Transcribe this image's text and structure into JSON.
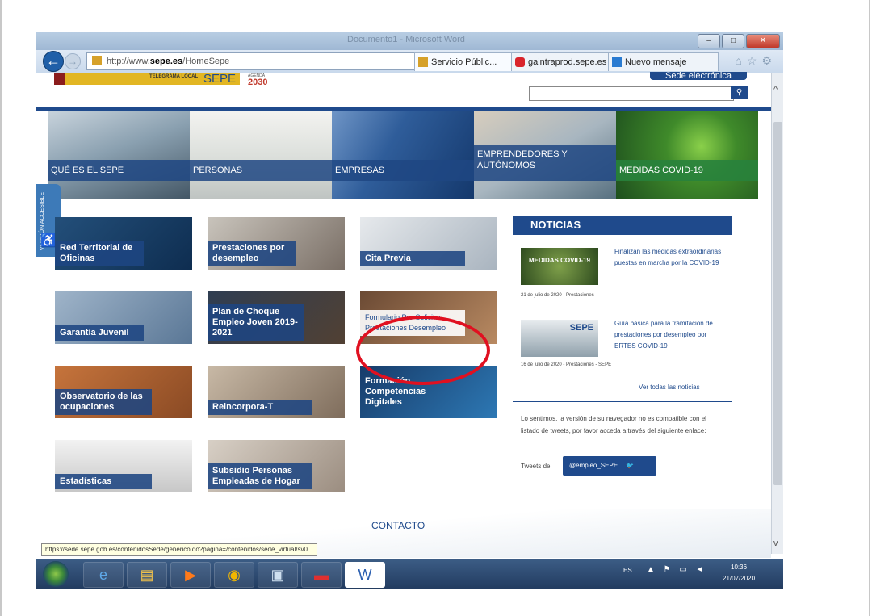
{
  "browser": {
    "window_title": "Documento1 - Microsoft Word",
    "address_url_prefix": "http://www.",
    "address_domain": "sepe.es",
    "address_path": "/HomeSepe",
    "tabs": [
      {
        "label": "Servicio Públic..."
      },
      {
        "label": "gaintraprod.sepe.es"
      },
      {
        "label": "Nuevo mensaje"
      }
    ],
    "status_url": "https://sede.sepe.gob.es/contenidosSede/generico.do?pagina=/contenidos/sede_virtual/sv0..."
  },
  "header": {
    "logo_text": "SEPE",
    "ministry_text": "TELEGRAMA LOCAL",
    "agenda_label": "AGENDA",
    "agenda_year": "2030",
    "sede_button": "Sede electrónica",
    "search_placeholder": ""
  },
  "accessibility": {
    "label": "VERSIÓN ACCESIBLE"
  },
  "banner": [
    {
      "label": "QUÉ ES EL SEPE"
    },
    {
      "label": "PERSONAS"
    },
    {
      "label": "EMPRESAS"
    },
    {
      "label": "EMPRENDEDORES Y AUTÓNOMOS"
    },
    {
      "label": "MEDIDAS COVID-19"
    }
  ],
  "tiles": [
    {
      "label": "Red Territorial de Oficinas"
    },
    {
      "label": "Prestaciones por desempleo"
    },
    {
      "label": "Cita Previa"
    },
    {
      "label": "Garantía Juvenil"
    },
    {
      "label": "Plan de Choque Empleo Joven 2019-2021"
    },
    {
      "label": "Formulario Pre-Solicitud Prestaciones Desempleo"
    },
    {
      "label": "Observatorio de las ocupaciones"
    },
    {
      "label": "Reincorpora-T"
    },
    {
      "label": "Formación Competencias Digitales"
    },
    {
      "label": "Estadísticas"
    },
    {
      "label": "Subsidio Personas Empleadas de Hogar"
    }
  ],
  "noticias": {
    "heading": "NOTICIAS",
    "items": [
      {
        "image_text": "MEDIDAS COVID-19",
        "title": "Finalizan las medidas extraordinarias puestas en marcha por la COVID-19",
        "date": "21 de julio de 2020 - Prestaciones"
      },
      {
        "image_text": "SEPE",
        "title": "Guía básica para la tramitación de prestaciones por desempleo por ERTES COVID-19",
        "date": "16 de julio de 2020 - Prestaciones - SEPE"
      }
    ],
    "see_all": "Ver todas las noticias",
    "twitter_message": "Lo sentimos, la versión de su navegador no es compatible con el listado de tweets, por favor acceda a través del siguiente enlace:",
    "tweets_label": "Tweets de",
    "tweets_handle": "@empleo_SEPE"
  },
  "footer": {
    "contacto": "CONTACTO"
  },
  "taskbar": {
    "language": "ES",
    "time": "10:36",
    "date": "21/07/2020"
  }
}
